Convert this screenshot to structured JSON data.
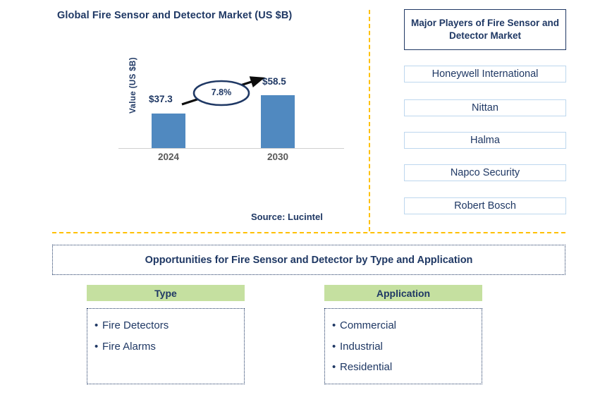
{
  "chart_panel": {
    "title": "Global Fire Sensor and Detector Market (US $B)",
    "source": "Source: Lucintel"
  },
  "chart_data": {
    "type": "bar",
    "title": "Global Fire Sensor and Detector Market (US $B)",
    "categories": [
      "2024",
      "2030"
    ],
    "values": [
      37.3,
      58.5
    ],
    "value_labels": [
      "$37.3",
      "$58.5"
    ],
    "xlabel": "",
    "ylabel": "Value (US $B)",
    "ylim": [
      0,
      65
    ],
    "grid": false,
    "legend": "none",
    "bar_color": "#5089c0",
    "annotations": [
      {
        "label": "7.8%",
        "shape": "ellipse-with-arrow",
        "from": "2024",
        "to": "2030",
        "meaning": "CAGR"
      }
    ]
  },
  "players_panel": {
    "header": "Major Players of Fire Sensor and Detector Market",
    "items": [
      {
        "name": "Honeywell International"
      },
      {
        "name": "Nittan"
      },
      {
        "name": "Halma"
      },
      {
        "name": "Napco Security"
      },
      {
        "name": "Robert Bosch"
      }
    ]
  },
  "opportunities": {
    "banner": "Opportunities for Fire Sensor and Detector by Type and Application",
    "columns": [
      {
        "header": "Type",
        "items": [
          "Fire Detectors",
          "Fire Alarms"
        ]
      },
      {
        "header": "Application",
        "items": [
          "Commercial",
          "Industrial",
          "Residential"
        ]
      }
    ]
  },
  "style": {
    "navy": "#1f3864",
    "bar_blue": "#5089c0",
    "divider_orange": "#ffc000",
    "header_green": "#c5e0a0",
    "box_border_blue": "#bdd7ee",
    "axis_gray": "#595959"
  },
  "icons": {
    "bullet": "•"
  }
}
